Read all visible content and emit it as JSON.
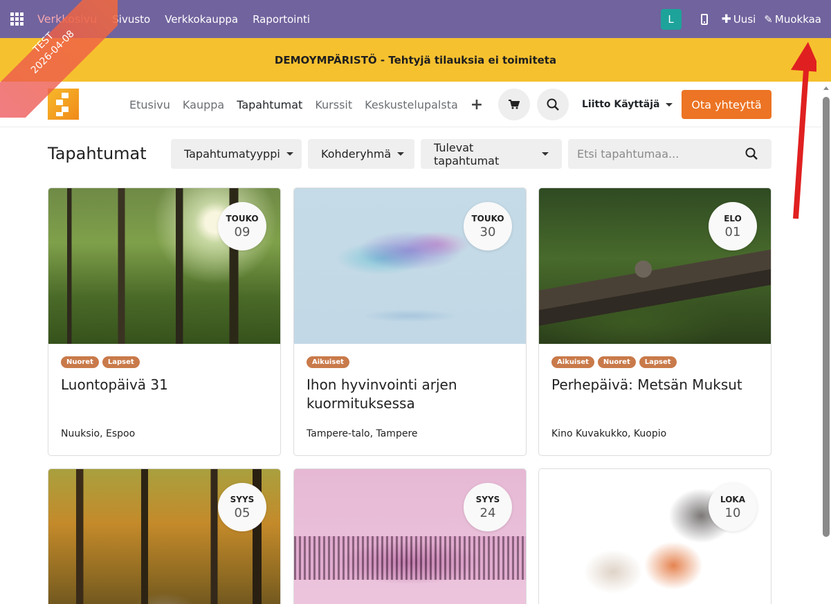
{
  "adminbar": {
    "brand": "Verkkosivu",
    "menu": [
      "Sivusto",
      "Verkkokauppa",
      "Raportointi"
    ],
    "avatar_letter": "L",
    "new_label": "Uusi",
    "edit_label": "Muokkaa"
  },
  "ribbon": {
    "line1": "TEST",
    "line2": "2026-04-08"
  },
  "demo_banner": "DEMOYMPÄRISTÖ - Tehtyjä tilauksia ei toimiteta",
  "header": {
    "nav": [
      "Etusivu",
      "Kauppa",
      "Tapahtumat",
      "Kurssit",
      "Keskustelupalsta"
    ],
    "active_nav": "Tapahtumat",
    "user": "Liitto Käyttäjä",
    "contact_label": "Ota yhteyttä"
  },
  "toolbar": {
    "title": "Tapahtumat",
    "filters": [
      "Tapahtumatyyppi",
      "Kohderyhmä",
      "Tulevat tapahtumat"
    ],
    "search_placeholder": "Etsi tapahtumaa..."
  },
  "events": [
    {
      "month": "TOUKO",
      "day": "09",
      "tags": [
        "Nuoret",
        "Lapset"
      ],
      "title": "Luontopäivä 31",
      "place": "Nuuksio, Espoo",
      "image": "forest-sunlight"
    },
    {
      "month": "TOUKO",
      "day": "30",
      "tags": [
        "Aikuiset"
      ],
      "title": "Ihon hyvinvointi arjen kuormituksessa",
      "place": "Tampere-talo, Tampere",
      "image": "colorful-particles"
    },
    {
      "month": "ELO",
      "day": "01",
      "tags": [
        "Aikuiset",
        "Nuoret",
        "Lapset"
      ],
      "title": "Perhepäivä: Metsän Muksut",
      "place": "Kino Kuvakukko, Kuopio",
      "image": "squirrel-on-log"
    },
    {
      "month": "SYYS",
      "day": "05",
      "tags": [],
      "title": "",
      "place": "",
      "image": "autumn-forest"
    },
    {
      "month": "SYYS",
      "day": "24",
      "tags": [],
      "title": "",
      "place": "",
      "image": "pink-soundwave"
    },
    {
      "month": "LOKA",
      "day": "10",
      "tags": [],
      "title": "",
      "place": "",
      "image": "watercolor-blots"
    }
  ],
  "colors": {
    "adminbar": "#71639e",
    "banner": "#f6c12f",
    "accent": "#ec7424",
    "tag": "#c97a4a"
  }
}
